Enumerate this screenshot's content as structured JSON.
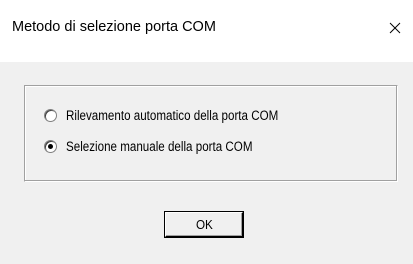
{
  "window": {
    "title": "Metodo di selezione porta COM",
    "close_icon": "close-icon"
  },
  "options": [
    {
      "label": "Rilevamento automatico della porta COM",
      "selected": false
    },
    {
      "label": "Selezione manuale della porta COM",
      "selected": true
    }
  ],
  "buttons": {
    "ok_label": "OK"
  },
  "colors": {
    "titlebar_bg": "#ffffff",
    "dialog_bg": "#f0f0f0",
    "text": "#000000"
  }
}
